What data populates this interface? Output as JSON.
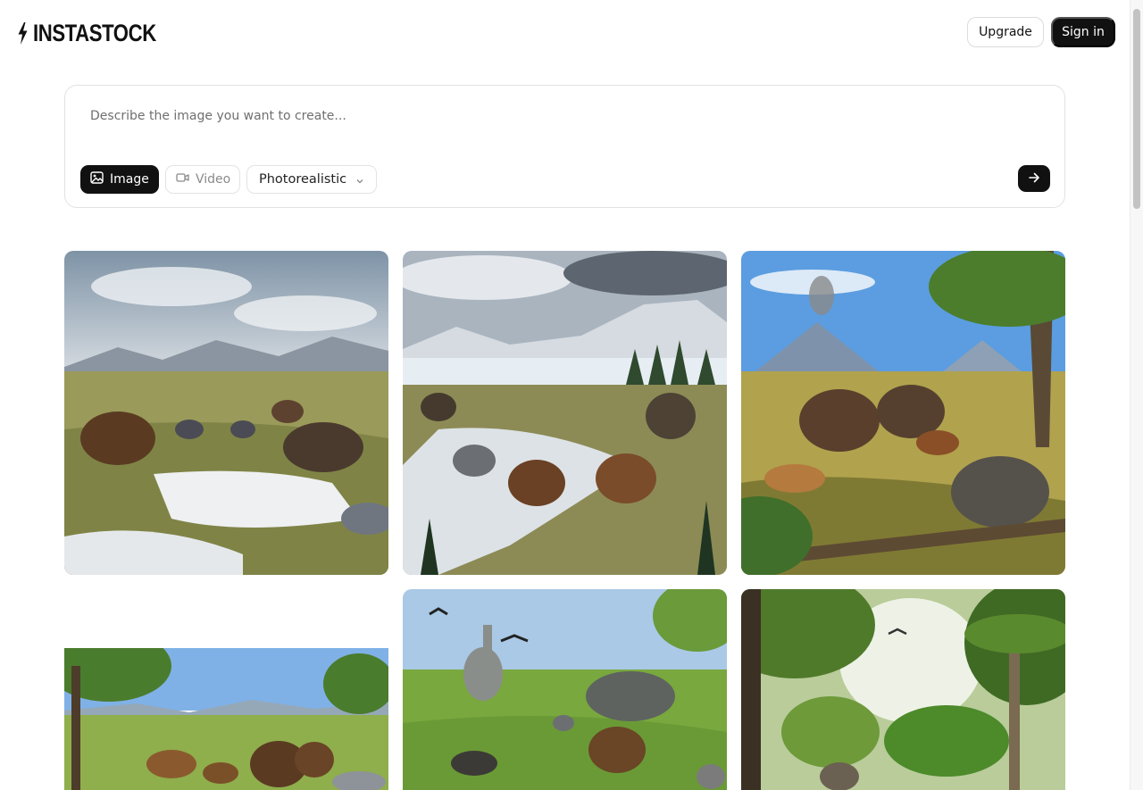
{
  "brand": {
    "name": "INSTASTOCK"
  },
  "header": {
    "upgrade_label": "Upgrade",
    "signin_label": "Sign in"
  },
  "prompt": {
    "placeholder": "Describe the image you want to create...",
    "value": "",
    "mode_image_label": "Image",
    "mode_video_label": "Video",
    "active_mode": "Image",
    "style_selected": "Photorealistic"
  },
  "icons": {
    "logo": "lightning-bolt-icon",
    "image_mode": "image-icon",
    "video_mode": "video-camera-icon",
    "style_dropdown": "chevron-down-icon",
    "submit": "arrow-right-icon"
  },
  "colors": {
    "primary": "#111111",
    "border": "#e2e2e2",
    "muted_text": "#8a8a8a"
  },
  "gallery": {
    "items": [
      "ice-age-steppe-mammoths-rhinos",
      "glacier-valley-mammoths-sabertooth",
      "volcano-savanna-mammoths-sloth",
      "grassland-mammoths-horses",
      "meadow-sauropod-triceratops",
      "tropical-forest-tree-ferns"
    ]
  }
}
